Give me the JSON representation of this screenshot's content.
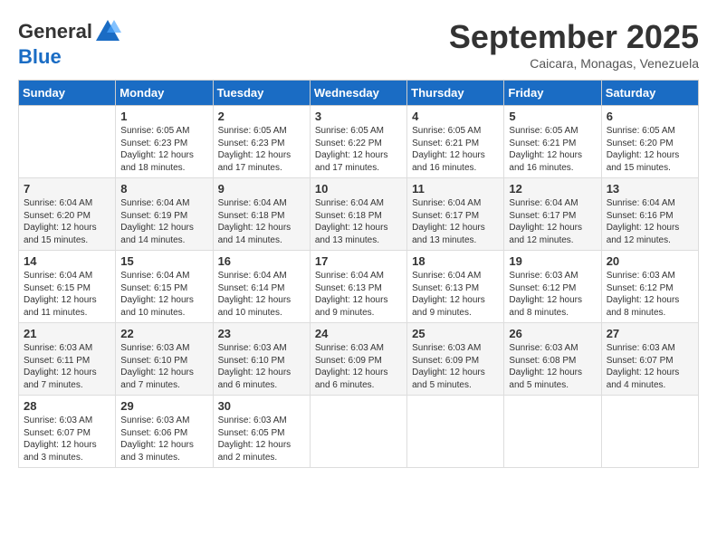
{
  "logo": {
    "general": "General",
    "blue": "Blue"
  },
  "title": "September 2025",
  "subtitle": "Caicara, Monagas, Venezuela",
  "headers": [
    "Sunday",
    "Monday",
    "Tuesday",
    "Wednesday",
    "Thursday",
    "Friday",
    "Saturday"
  ],
  "weeks": [
    [
      {
        "day": "",
        "info": ""
      },
      {
        "day": "1",
        "info": "Sunrise: 6:05 AM\nSunset: 6:23 PM\nDaylight: 12 hours\nand 18 minutes."
      },
      {
        "day": "2",
        "info": "Sunrise: 6:05 AM\nSunset: 6:23 PM\nDaylight: 12 hours\nand 17 minutes."
      },
      {
        "day": "3",
        "info": "Sunrise: 6:05 AM\nSunset: 6:22 PM\nDaylight: 12 hours\nand 17 minutes."
      },
      {
        "day": "4",
        "info": "Sunrise: 6:05 AM\nSunset: 6:21 PM\nDaylight: 12 hours\nand 16 minutes."
      },
      {
        "day": "5",
        "info": "Sunrise: 6:05 AM\nSunset: 6:21 PM\nDaylight: 12 hours\nand 16 minutes."
      },
      {
        "day": "6",
        "info": "Sunrise: 6:05 AM\nSunset: 6:20 PM\nDaylight: 12 hours\nand 15 minutes."
      }
    ],
    [
      {
        "day": "7",
        "info": "Sunrise: 6:04 AM\nSunset: 6:20 PM\nDaylight: 12 hours\nand 15 minutes."
      },
      {
        "day": "8",
        "info": "Sunrise: 6:04 AM\nSunset: 6:19 PM\nDaylight: 12 hours\nand 14 minutes."
      },
      {
        "day": "9",
        "info": "Sunrise: 6:04 AM\nSunset: 6:18 PM\nDaylight: 12 hours\nand 14 minutes."
      },
      {
        "day": "10",
        "info": "Sunrise: 6:04 AM\nSunset: 6:18 PM\nDaylight: 12 hours\nand 13 minutes."
      },
      {
        "day": "11",
        "info": "Sunrise: 6:04 AM\nSunset: 6:17 PM\nDaylight: 12 hours\nand 13 minutes."
      },
      {
        "day": "12",
        "info": "Sunrise: 6:04 AM\nSunset: 6:17 PM\nDaylight: 12 hours\nand 12 minutes."
      },
      {
        "day": "13",
        "info": "Sunrise: 6:04 AM\nSunset: 6:16 PM\nDaylight: 12 hours\nand 12 minutes."
      }
    ],
    [
      {
        "day": "14",
        "info": "Sunrise: 6:04 AM\nSunset: 6:15 PM\nDaylight: 12 hours\nand 11 minutes."
      },
      {
        "day": "15",
        "info": "Sunrise: 6:04 AM\nSunset: 6:15 PM\nDaylight: 12 hours\nand 10 minutes."
      },
      {
        "day": "16",
        "info": "Sunrise: 6:04 AM\nSunset: 6:14 PM\nDaylight: 12 hours\nand 10 minutes."
      },
      {
        "day": "17",
        "info": "Sunrise: 6:04 AM\nSunset: 6:13 PM\nDaylight: 12 hours\nand 9 minutes."
      },
      {
        "day": "18",
        "info": "Sunrise: 6:04 AM\nSunset: 6:13 PM\nDaylight: 12 hours\nand 9 minutes."
      },
      {
        "day": "19",
        "info": "Sunrise: 6:03 AM\nSunset: 6:12 PM\nDaylight: 12 hours\nand 8 minutes."
      },
      {
        "day": "20",
        "info": "Sunrise: 6:03 AM\nSunset: 6:12 PM\nDaylight: 12 hours\nand 8 minutes."
      }
    ],
    [
      {
        "day": "21",
        "info": "Sunrise: 6:03 AM\nSunset: 6:11 PM\nDaylight: 12 hours\nand 7 minutes."
      },
      {
        "day": "22",
        "info": "Sunrise: 6:03 AM\nSunset: 6:10 PM\nDaylight: 12 hours\nand 7 minutes."
      },
      {
        "day": "23",
        "info": "Sunrise: 6:03 AM\nSunset: 6:10 PM\nDaylight: 12 hours\nand 6 minutes."
      },
      {
        "day": "24",
        "info": "Sunrise: 6:03 AM\nSunset: 6:09 PM\nDaylight: 12 hours\nand 6 minutes."
      },
      {
        "day": "25",
        "info": "Sunrise: 6:03 AM\nSunset: 6:09 PM\nDaylight: 12 hours\nand 5 minutes."
      },
      {
        "day": "26",
        "info": "Sunrise: 6:03 AM\nSunset: 6:08 PM\nDaylight: 12 hours\nand 5 minutes."
      },
      {
        "day": "27",
        "info": "Sunrise: 6:03 AM\nSunset: 6:07 PM\nDaylight: 12 hours\nand 4 minutes."
      }
    ],
    [
      {
        "day": "28",
        "info": "Sunrise: 6:03 AM\nSunset: 6:07 PM\nDaylight: 12 hours\nand 3 minutes."
      },
      {
        "day": "29",
        "info": "Sunrise: 6:03 AM\nSunset: 6:06 PM\nDaylight: 12 hours\nand 3 minutes."
      },
      {
        "day": "30",
        "info": "Sunrise: 6:03 AM\nSunset: 6:05 PM\nDaylight: 12 hours\nand 2 minutes."
      },
      {
        "day": "",
        "info": ""
      },
      {
        "day": "",
        "info": ""
      },
      {
        "day": "",
        "info": ""
      },
      {
        "day": "",
        "info": ""
      }
    ]
  ]
}
